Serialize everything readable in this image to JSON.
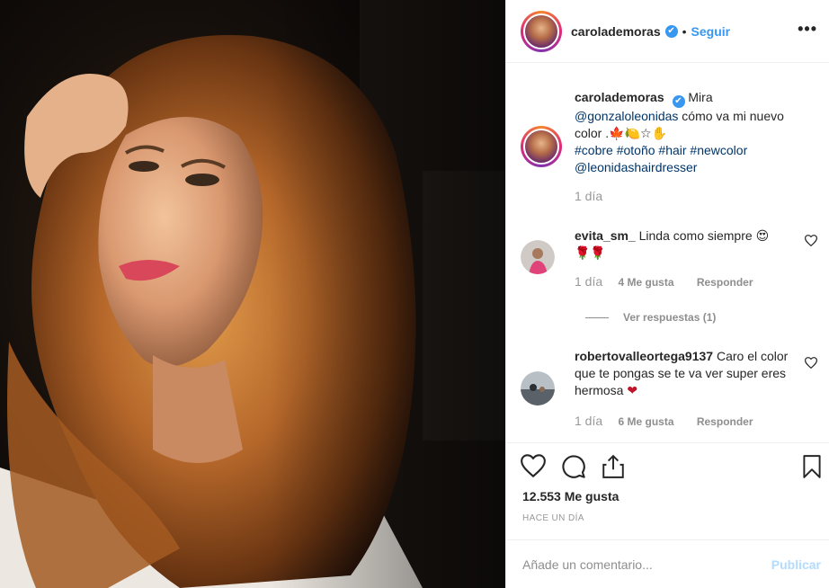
{
  "post": {
    "image_alt": "Selfie of woman with long wavy copper hair"
  },
  "header": {
    "username": "carolademoras",
    "verified_badge": "✔",
    "separator": "•",
    "follow_label": "Seguir",
    "more_label": "•••"
  },
  "caption": {
    "username": "carolademoras",
    "text_start": "Mira",
    "mention": "@gonzaloleonidas",
    "text_mid": "cómo va mi nuevo color .",
    "emojis": "🍁🍋☆✋",
    "hashtags": "#cobre #otoño #hair #newcolor",
    "mention2": "@leonidashairdresser",
    "time": "1 día"
  },
  "comments": [
    {
      "username": "evita_sm_",
      "text": "Linda como siempre",
      "emoji_line1": "😍",
      "emoji_line2": "🌹🌹",
      "time": "1 día",
      "likes": "4 Me gusta",
      "reply_label": "Responder",
      "view_replies": "Ver respuestas (1)"
    },
    {
      "username": "robertovalleortega9137",
      "text": "Caro el color que te pongas se te va ver super eres hermosa",
      "emoji": "❤",
      "time": "1 día",
      "likes": "6 Me gusta",
      "reply_label": "Responder"
    }
  ],
  "actions": {
    "icons": [
      "heart-icon",
      "comment-icon",
      "share-icon",
      "bookmark-icon"
    ],
    "likes_count": "12.553 Me gusta",
    "timestamp": "HACE UN DÍA"
  },
  "add_comment": {
    "placeholder": "Añade un comentario...",
    "publish_label": "Publicar"
  },
  "colors": {
    "link": "#003569",
    "accent": "#3897f0",
    "muted": "#8e8e8e",
    "publish_disabled": "#b3dbff",
    "heart_red": "#c0142a"
  }
}
